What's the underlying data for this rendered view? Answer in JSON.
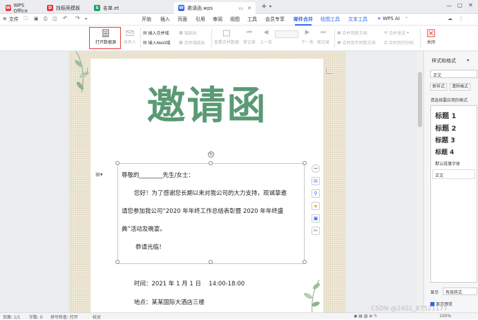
{
  "tabs": [
    {
      "label": "WPS Office",
      "color": "#e8343c",
      "glyph": "W"
    },
    {
      "label": "找稻壳模板",
      "color": "#e8343c",
      "glyph": "D"
    },
    {
      "label": "名单.et",
      "color": "#1aa260",
      "glyph": "S"
    },
    {
      "label": "邀请函.wps",
      "color": "#3167e6",
      "glyph": "W",
      "active": true
    }
  ],
  "toolbar": {
    "file_label": "文件"
  },
  "menus": [
    "开始",
    "插入",
    "页面",
    "引用",
    "审阅",
    "视图",
    "工具",
    "会员专享",
    "邮件合并",
    "绘图工具",
    "文本工具",
    "WPS AI"
  ],
  "ribbon": {
    "open_source": "打开数据源",
    "recipients": "收件人",
    "insert_field": "插入合并域",
    "insert_next": "插入Next域",
    "field_shading": "域底纹",
    "merge_field_disabled": "合并域底纹",
    "view_merged": "查看合并数据",
    "first_record": "首记录",
    "prev": "上一条",
    "next": "下一条",
    "last_record": "尾记录",
    "merge_new_doc": "合并到新文档",
    "merge_diff_docs": "合并到不同新文档",
    "merge_email": "合并发送",
    "merge_printer": "合并到打印机",
    "close": "关闭"
  },
  "document": {
    "title": "邀请函",
    "greeting": "尊敬的________先生/女士：",
    "para1_a": "您好！为了感谢您长期以来对我公司的大力支持，现诚挚邀",
    "para1_b": "请您参加我公司“2020 年年终工作总结表彰暨 2020 年年终盛",
    "para1_c": "典”活动及晚宴。",
    "welcome": "恭请光临！",
    "time": "时间：2021 年 1 月 1 日　 14:00-18:00",
    "place": "地点：某某国际大酒店三楼"
  },
  "panel": {
    "title": "样式和格式",
    "current_style": "正文",
    "new_style": "新样式",
    "clear_format": "清除格式",
    "hint": "请选择要应用的格式",
    "styles": [
      "标题 1",
      "标题 2",
      "标题 3",
      "标题 4"
    ],
    "default_font": "默认段落字体",
    "body": "正文",
    "show_label": "显示",
    "show_value": "有效样式",
    "preview_label": "显示预览"
  },
  "status": {
    "page": "页面: 1/1",
    "words": "字数: 0",
    "spell": "拼写检查: 打开",
    "proof": "校对",
    "zoom": "100%"
  },
  "watermark": "CSDN @2401_87521177",
  "colors": {
    "accent": "#3167e6",
    "title_green": "#5a9a74",
    "highlight": "#e53935"
  }
}
